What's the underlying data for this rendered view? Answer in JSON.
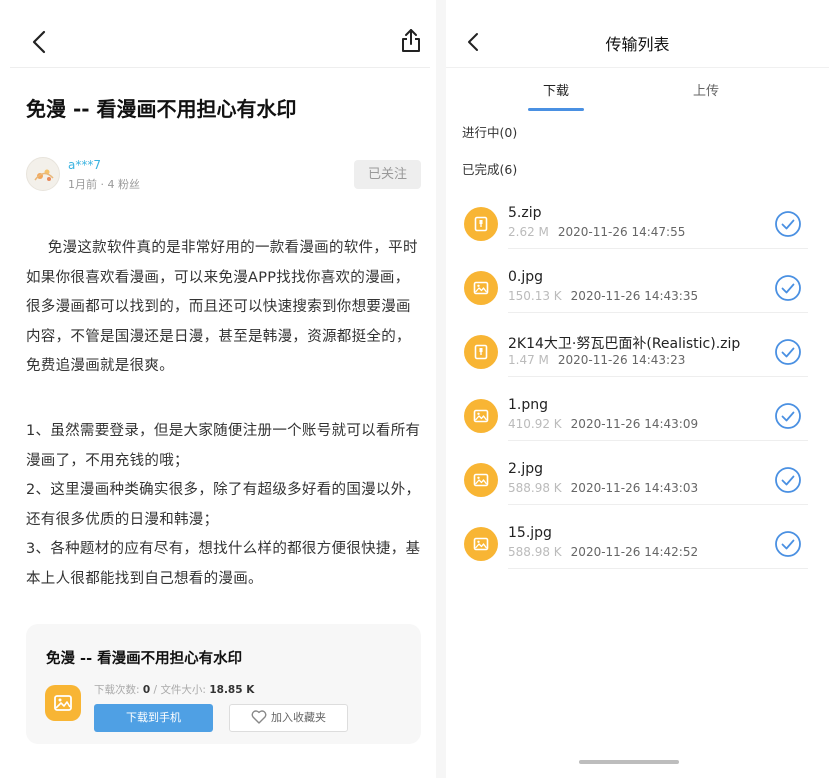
{
  "left": {
    "article_title": "免漫 -- 看漫画不用担心有水印",
    "author": {
      "name": "a***7",
      "meta": "1月前 · 4 粉丝",
      "follow_label": "已关注"
    },
    "paragraph1": "免漫这款软件真的是非常好用的一款看漫画的软件，平时如果你很喜欢看漫画，可以来免漫APP找找你喜欢的漫画，很多漫画都可以找到的，而且还可以快速搜索到你想要漫画内容，不管是国漫还是日漫，甚至是韩漫，资源都挺全的，免费追漫画就是很爽。",
    "paragraph2_lines": [
      "1、虽然需要登录，但是大家随便注册一个账号就可以看所有漫画了，不用充钱的哦；",
      "2、这里漫画种类确实很多，除了有超级多好看的国漫以外，还有很多优质的日漫和韩漫；",
      "3、各种题材的应有尽有，想找什么样的都很方便很快捷，基本上人很都能找到自己想看的漫画。"
    ],
    "card": {
      "title": "免漫 -- 看漫画不用担心有水印",
      "downloads_label": "下载次数:",
      "downloads_value": "0",
      "separator": "/",
      "size_label": "文件大小:",
      "size_value": "18.85 K",
      "download_button": "下载到手机",
      "favorite_button": "加入收藏夹"
    }
  },
  "right": {
    "title": "传输列表",
    "tabs": [
      "下载",
      "上传"
    ],
    "active_tab": "下载",
    "in_progress_label": "进行中(0)",
    "completed_label": "已完成(6)",
    "accent_color": "#4a90e2",
    "icon_color": "#f8b534",
    "files": [
      {
        "name": "5.zip",
        "size": "2.62 M",
        "datetime": "2020-11-26 14:47:55",
        "icon": "zip-file-icon"
      },
      {
        "name": "0.jpg",
        "size": "150.13 K",
        "datetime": "2020-11-26 14:43:35",
        "icon": "image-file-icon"
      },
      {
        "name": "2K14大卫·努瓦巴面补(Realistic).zip",
        "size": "1.47 M",
        "datetime": "2020-11-26 14:43:23",
        "icon": "zip-file-icon"
      },
      {
        "name": "1.png",
        "size": "410.92 K",
        "datetime": "2020-11-26 14:43:09",
        "icon": "image-file-icon"
      },
      {
        "name": "2.jpg",
        "size": "588.98 K",
        "datetime": "2020-11-26 14:43:03",
        "icon": "image-file-icon"
      },
      {
        "name": "15.jpg",
        "size": "588.98 K",
        "datetime": "2020-11-26 14:42:52",
        "icon": "image-file-icon"
      }
    ]
  }
}
